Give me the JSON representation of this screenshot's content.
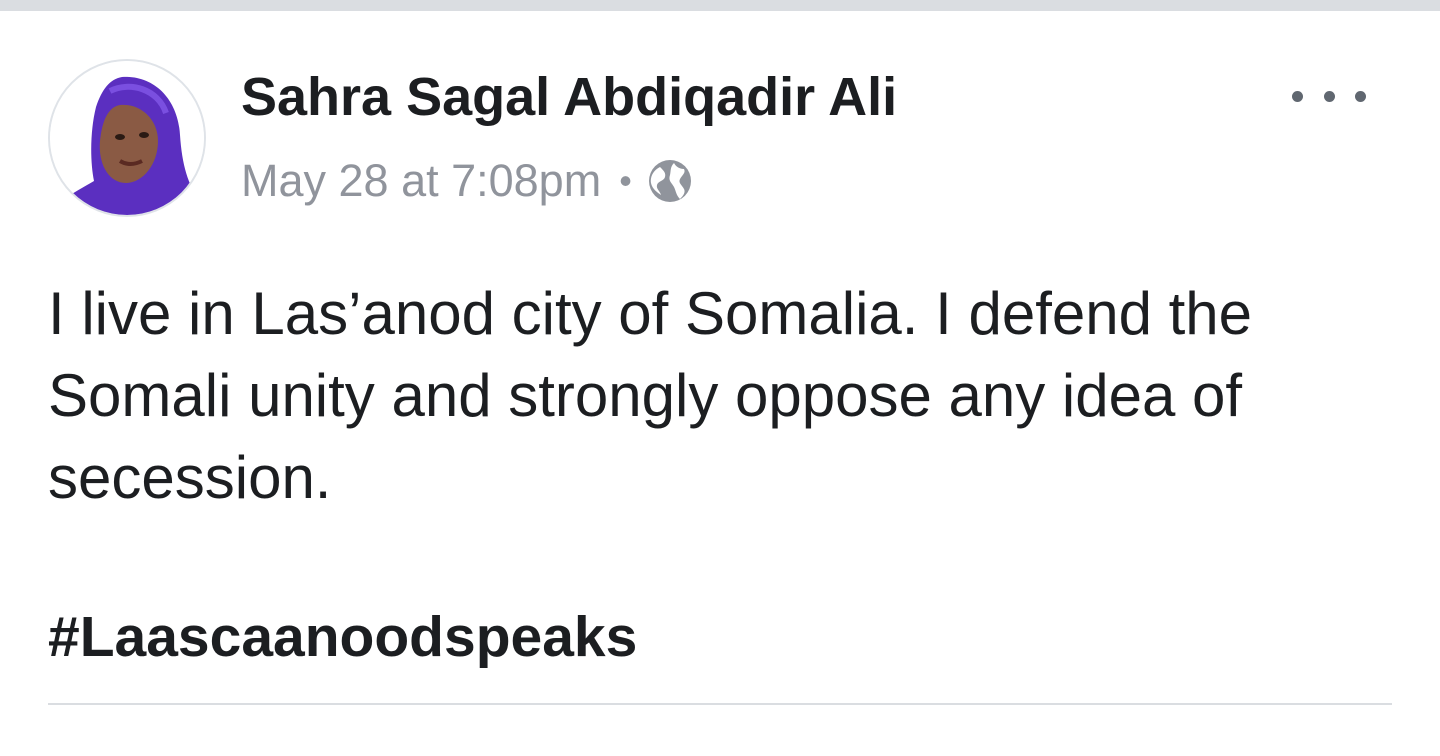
{
  "post": {
    "author": "Sahra Sagal Abdiqadir Ali",
    "timestamp": "May 28 at 7:08pm",
    "separator": "•",
    "privacy_icon": "globe-icon",
    "more_icon": "more-options-icon",
    "body": "I live in Las’anod city of Somalia. I defend the Somali unity and strongly oppose any idea of secession.",
    "hashtag": "#Laascaanoodspeaks"
  },
  "colors": {
    "text_primary": "#1c1e21",
    "text_secondary": "#90949c",
    "divider": "#dadde1",
    "avatar_hijab": "#5b2fc0"
  }
}
